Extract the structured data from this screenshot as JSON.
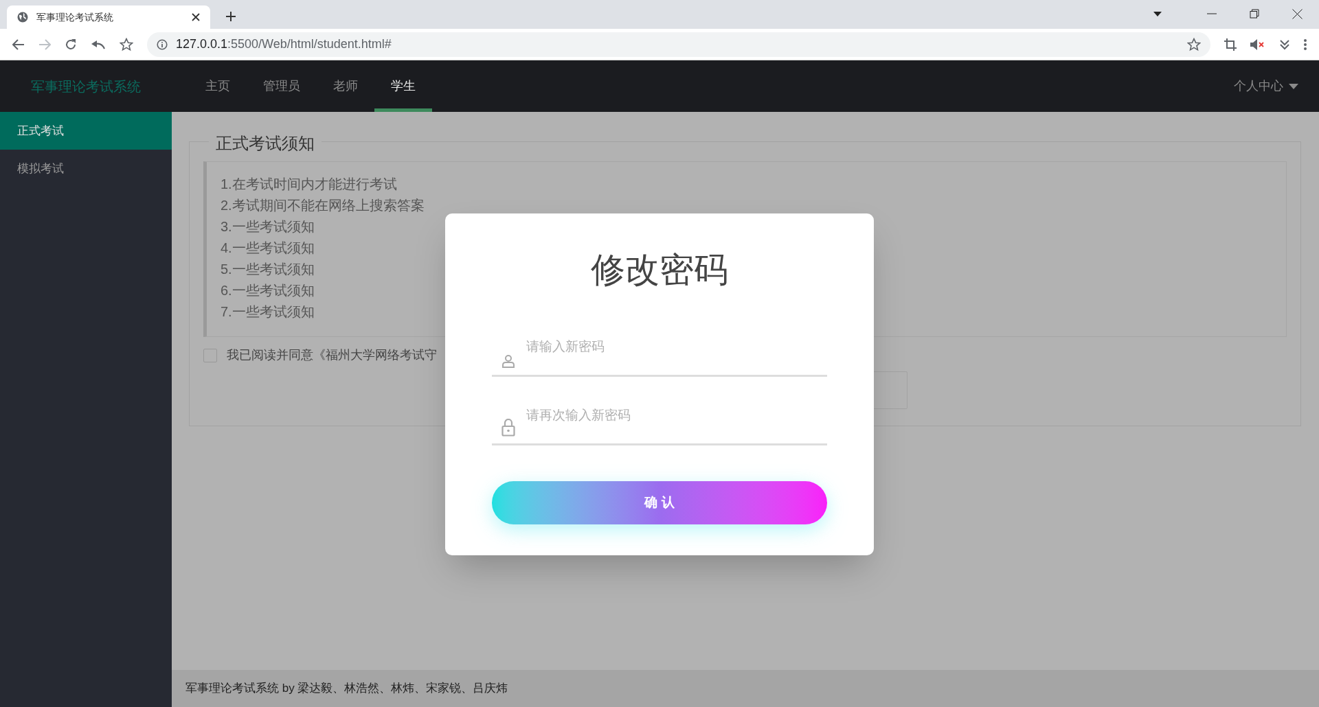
{
  "browser": {
    "tab_title": "军事理论考试系统",
    "url_host": "127.0.0.1",
    "url_rest": ":5500/Web/html/student.html#",
    "forward_disabled": true
  },
  "nav": {
    "brand": "军事理论考试系统",
    "items": [
      {
        "label": "主页",
        "selected": false
      },
      {
        "label": "管理员",
        "selected": false
      },
      {
        "label": "老师",
        "selected": false
      },
      {
        "label": "学生",
        "selected": true
      }
    ],
    "user_menu": "个人中心"
  },
  "sidebar": {
    "items": [
      {
        "label": "正式考试",
        "selected": true
      },
      {
        "label": "模拟考试",
        "selected": false
      }
    ]
  },
  "notice": {
    "legend": "正式考试须知",
    "items": [
      "1.在考试时间内才能进行考试",
      "2.考试期间不能在网络上搜索答案",
      "3.一些考试须知",
      "4.一些考试须知",
      "5.一些考试须知",
      "6.一些考试须知",
      "7.一些考试须知"
    ],
    "agree": {
      "label": "我已阅读并同意《福州大学网络考试守",
      "checked": false
    }
  },
  "modal": {
    "title": "修改密码",
    "fields": [
      {
        "kind": "user",
        "placeholder": "请输入新密码"
      },
      {
        "kind": "lock",
        "placeholder": "请再次输入新密码"
      }
    ],
    "confirm": "确 认"
  },
  "footer": "军事理论考试系统 by 梁达毅、林浩然、林炜、宋家锐、吕庆炜"
}
